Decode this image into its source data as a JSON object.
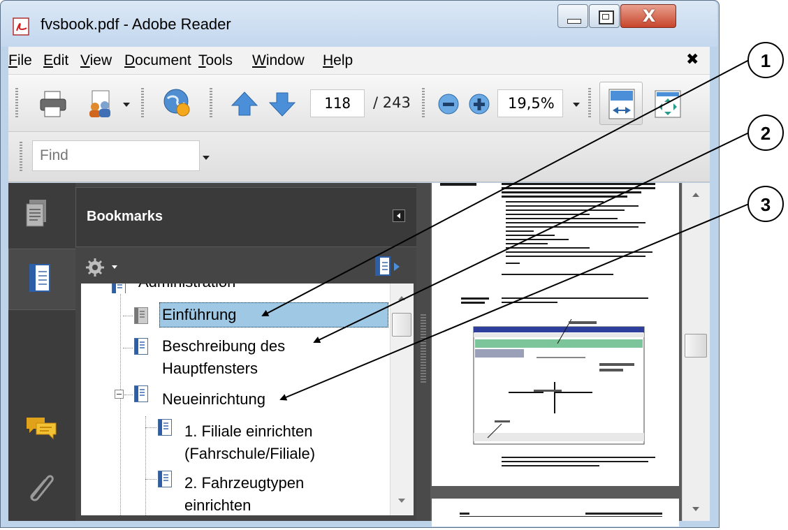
{
  "window": {
    "title": "fvsbook.pdf - Adobe Reader",
    "close_glyph": "X"
  },
  "menu": {
    "items": [
      {
        "label": "File",
        "key": "F",
        "rest": "ile"
      },
      {
        "label": "Edit",
        "key": "E",
        "rest": "dit"
      },
      {
        "label": "View",
        "key": "V",
        "rest": "iew"
      },
      {
        "label": "Document",
        "key": "D",
        "rest": "ocument"
      },
      {
        "label": "Tools",
        "key": "T",
        "rest": "ools"
      },
      {
        "label": "Window",
        "key": "W",
        "rest": "indow"
      },
      {
        "label": "Help",
        "key": "H",
        "rest": "elp"
      }
    ],
    "close_glyph": "✖"
  },
  "toolbar": {
    "current_page": "118",
    "total_pages": "/ 243",
    "zoom": "19,5%"
  },
  "find": {
    "placeholder": "Find"
  },
  "bookmarks": {
    "title": "Bookmarks",
    "items": [
      {
        "label": "Administration"
      },
      {
        "label": "Einführung"
      },
      {
        "label": "Beschreibung des",
        "label2": "Hauptfensters"
      },
      {
        "label": "Neueinrichtung"
      },
      {
        "label": "1. Filiale einrichten",
        "label2": "(Fahrschule/Filiale)"
      },
      {
        "label": "2. Fahrzeugtypen",
        "label2": "einrichten"
      }
    ]
  },
  "callouts": [
    "1",
    "2",
    "3"
  ],
  "icons": {
    "print": "printer-icon",
    "share": "share-people-icon",
    "collaborate": "globe-collaborate-icon",
    "prev": "arrow-up-icon",
    "next": "arrow-down-icon",
    "zoom_out": "zoom-out-icon",
    "zoom_in": "zoom-in-icon",
    "fit_width": "fit-width-icon",
    "fit_page": "fit-page-icon"
  }
}
